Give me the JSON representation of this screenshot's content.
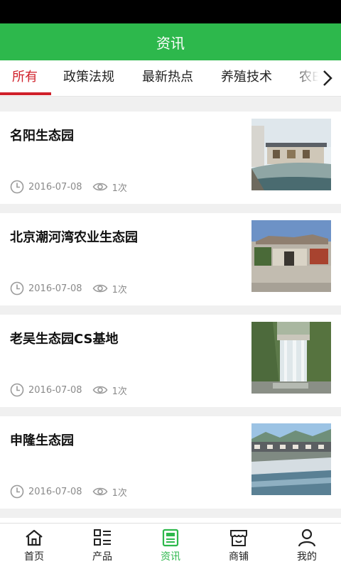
{
  "header": {
    "title": "资讯"
  },
  "tabs": [
    {
      "label": "所有"
    },
    {
      "label": "政策法规"
    },
    {
      "label": "最新热点"
    },
    {
      "label": "养殖技术"
    },
    {
      "label": "农E"
    }
  ],
  "articles": [
    {
      "title": "名阳生态园",
      "date": "2016-07-08",
      "views": "1次"
    },
    {
      "title": "北京潮河湾农业生态园",
      "date": "2016-07-08",
      "views": "1次"
    },
    {
      "title": "老吴生态园CS基地",
      "date": "2016-07-08",
      "views": "1次"
    },
    {
      "title": "申隆生态园",
      "date": "2016-07-08",
      "views": "1次"
    }
  ],
  "bottom_nav": [
    {
      "label": "首页",
      "icon": "home-icon"
    },
    {
      "label": "产品",
      "icon": "grid-list-icon"
    },
    {
      "label": "资讯",
      "icon": "news-icon"
    },
    {
      "label": "商铺",
      "icon": "shop-icon"
    },
    {
      "label": "我的",
      "icon": "user-icon"
    }
  ],
  "colors": {
    "accent": "#2db84c",
    "active_tab": "#d0202a"
  }
}
